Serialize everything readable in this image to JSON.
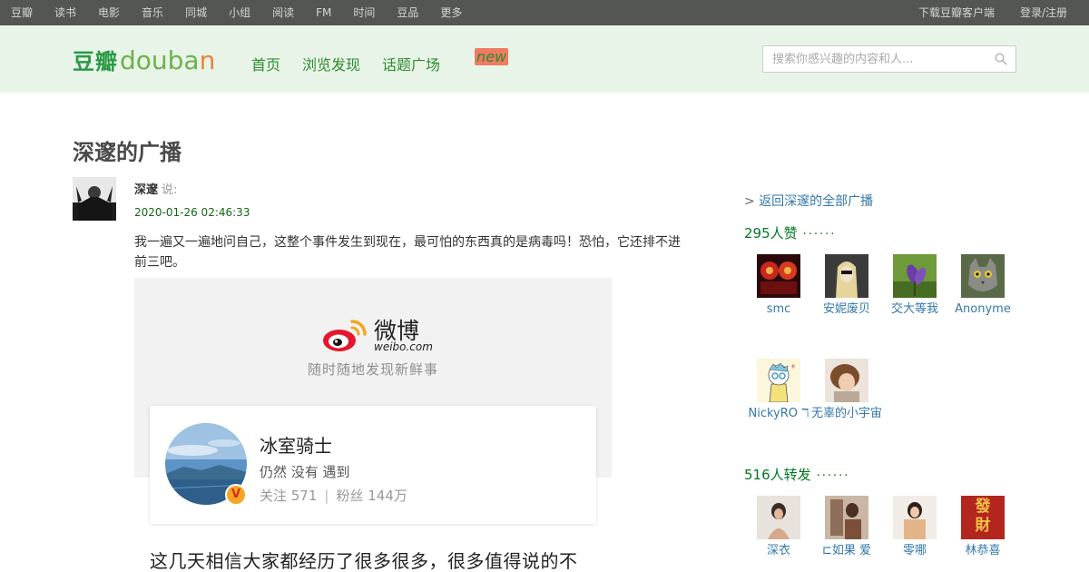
{
  "topbar": {
    "items": [
      "豆瓣",
      "读书",
      "电影",
      "音乐",
      "同城",
      "小组",
      "阅读",
      "FM",
      "时间",
      "豆品",
      "更多"
    ],
    "download": "下载豆瓣客户端",
    "login": "登录/注册"
  },
  "header": {
    "logo_cn": "豆瓣",
    "logo_en_1": "douba",
    "logo_en_2": "n",
    "nav": [
      "首页",
      "浏览发现",
      "话题广场"
    ],
    "new_tag": "new",
    "search_placeholder": "搜索你感兴趣的内容和人..."
  },
  "main": {
    "title": "深邃的广播",
    "author": "深邃",
    "said": "说:",
    "time": "2020-01-26 02:46:33",
    "text": "我一遍又一遍地问自己，这整个事件发生到现在，最可怕的东西真的是病毒吗！恐怕，它还排不进前三吧。",
    "card": {
      "weibo_cn": "微博",
      "weibo_en": "weibo.com",
      "tagline": "随时随地发现新鲜事",
      "profile_name": "冰室骑士",
      "profile_desc": "仍然 没有 遇到",
      "following": "关注 571",
      "sep": "|",
      "followers": "粉丝 144万",
      "v_badge": "V",
      "body": "这几天相信大家都经历了很多很多，很多值得说的不"
    }
  },
  "side": {
    "back_link": "返回深邃的全部广播",
    "likes_title": "295人赞",
    "likes_dots": "······",
    "likers": [
      "smc",
      "安妮废贝",
      "交大等我",
      "Anonyme",
      "NickyRO ℸ",
      "无辜的小宇宙"
    ],
    "reshare_title": "516人转发",
    "reshare_dots": "······",
    "resharers": [
      "深衣",
      "⊏如果 爱",
      "零哪",
      "林恭喜"
    ],
    "fa_cai": "發財"
  },
  "colors": {
    "topbar_bg": "#545652",
    "header_bg": "#e9f4e9",
    "accent_green": "#072",
    "link_blue": "#37a"
  }
}
